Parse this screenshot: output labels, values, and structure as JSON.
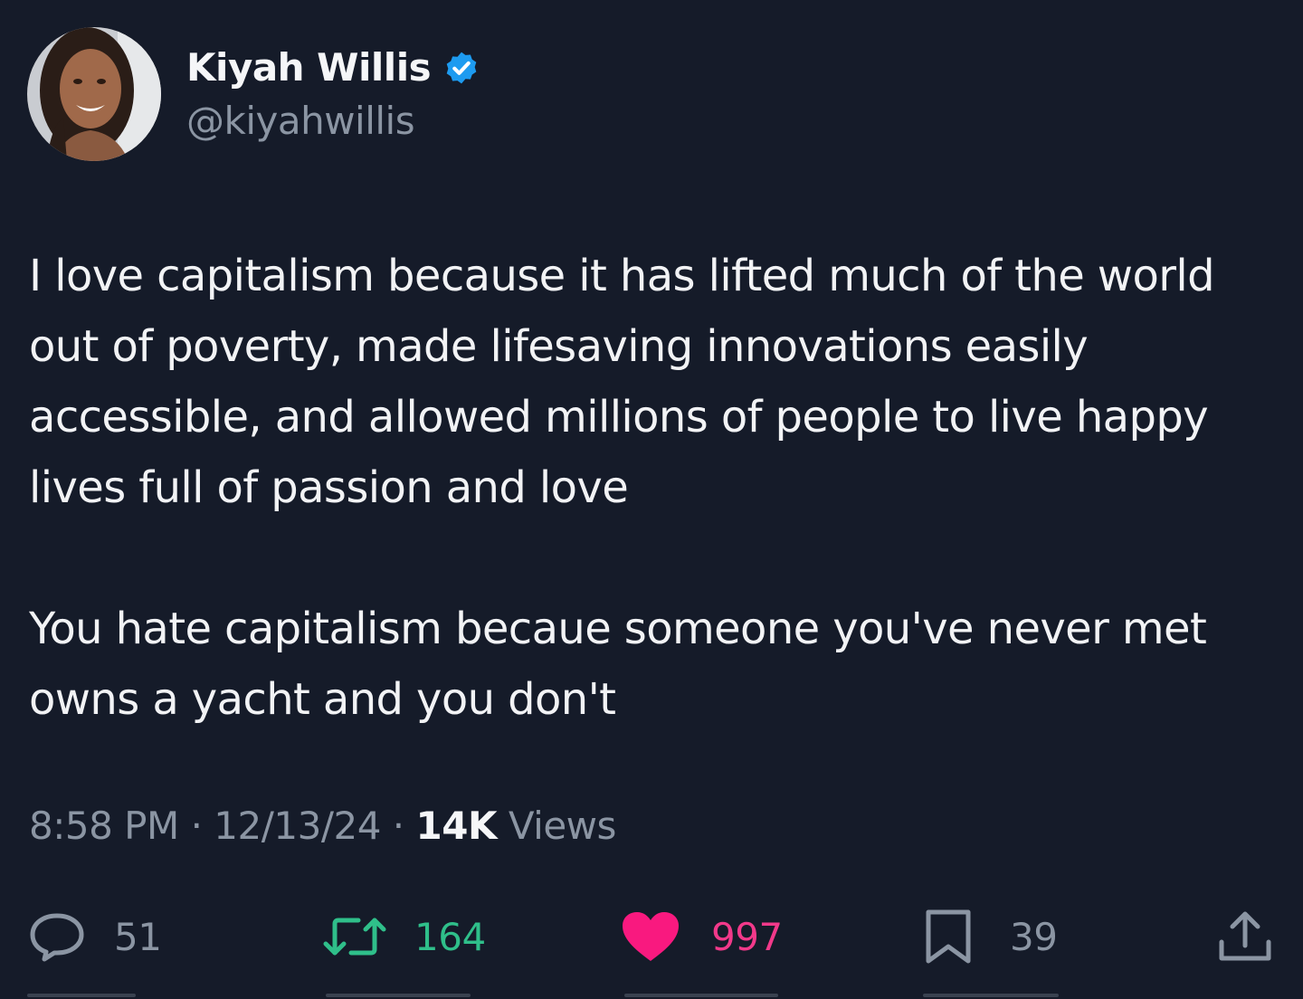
{
  "author": {
    "display_name": "Kiyah Willis",
    "handle": "@kiyahwillis",
    "verified": true,
    "verified_icon": "verified-badge-icon"
  },
  "tweet": {
    "paragraphs": [
      "I love capitalism because it has lifted much of the world out of poverty, made lifesaving innovations easily accessible, and allowed millions of people to live happy lives full of passion and love",
      "You hate capitalism becaue someone you've never met owns a yacht and you don't"
    ]
  },
  "meta": {
    "time": "8:58 PM",
    "separator": " · ",
    "date": "12/13/24",
    "views_count": "14K",
    "views_label": "Views"
  },
  "actions": {
    "replies": "51",
    "retweets": "164",
    "likes": "997",
    "bookmarks": "39"
  },
  "colors": {
    "background": "#151b29",
    "text": "#f2f3f5",
    "muted": "#8b95a3",
    "verified": "#1d9bf0",
    "retweet": "#2fbf8a",
    "like": "#f2398a"
  }
}
